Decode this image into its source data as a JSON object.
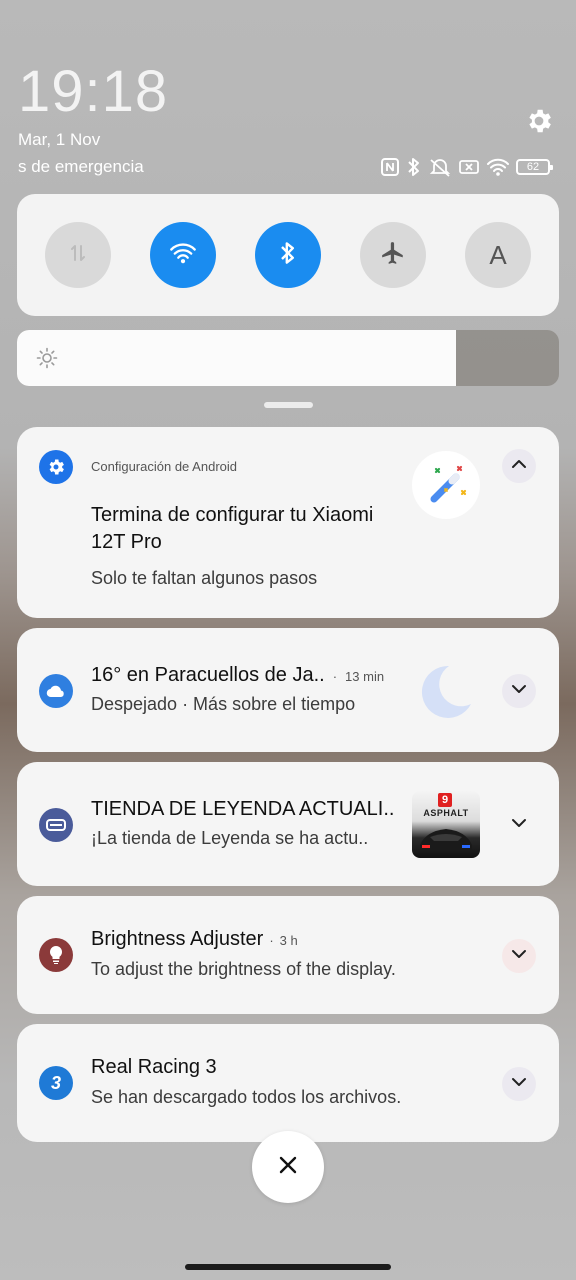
{
  "status": {
    "time": "19:18",
    "date": "Mar, 1 Nov",
    "carrier_text": "s de emergencia",
    "battery": "62",
    "icons": [
      "nfc-icon",
      "bluetooth-icon",
      "vibrate-off-icon",
      "no-sim-icon",
      "wifi-icon",
      "battery-icon"
    ]
  },
  "quick_toggles": [
    {
      "name": "mobile-data",
      "state": "off",
      "icon": "data-arrows-icon"
    },
    {
      "name": "wifi",
      "state": "on",
      "icon": "wifi-icon"
    },
    {
      "name": "bluetooth",
      "state": "on",
      "icon": "bluetooth-icon"
    },
    {
      "name": "airplane",
      "state": "off",
      "icon": "airplane-icon"
    },
    {
      "name": "auto-brightness",
      "state": "off",
      "label": "A"
    }
  ],
  "brightness": {
    "level": 0.81
  },
  "notifications": [
    {
      "app": "Configuración de Android",
      "title": "Termina de configurar tu Xiaomi 12T Pro",
      "body": "Solo te faltan algunos pasos"
    },
    {
      "title": "16° en Paracuellos de Ja..",
      "time": "13 min",
      "body": "Despejado · Más sobre el tiempo"
    },
    {
      "title": "TIENDA DE LEYENDA ACTUALI..",
      "body": "¡La tienda de Leyenda se ha actu..",
      "thumb_brand": "ASPHALT",
      "thumb_badge": "9"
    },
    {
      "title": "Brightness Adjuster",
      "time": "3 h",
      "body": "To adjust the brightness of the display."
    },
    {
      "title": "Real Racing 3",
      "body": "Se han descargado todos los archivos.",
      "icon_text": "3"
    }
  ],
  "colors": {
    "accent": "#1a8cf0",
    "android_settings": "#1e73e8",
    "weather": "#2f7fe0",
    "asphalt": "#4a5b9a",
    "brightness_app": "#8b3a3a",
    "real_racing": "#1f7ad6"
  }
}
